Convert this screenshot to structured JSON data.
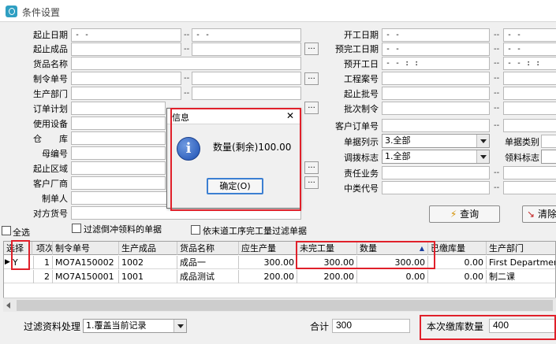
{
  "window": {
    "title": "条件设置"
  },
  "filters_left": [
    {
      "label": "起止日期",
      "from": "- -",
      "to": "- -"
    },
    {
      "label": "起止成品",
      "from": "",
      "to": ""
    },
    {
      "label": "货品名称",
      "value": ""
    },
    {
      "label": "制令单号",
      "from": "",
      "to": ""
    },
    {
      "label": "生产部门",
      "from": "",
      "to": ""
    },
    {
      "label": "订单计划",
      "from": "",
      "to": ""
    },
    {
      "label": "使用设备",
      "from": "",
      "to": ""
    },
    {
      "label": "仓　　库",
      "from": "",
      "to": ""
    },
    {
      "label": "母编号",
      "from": "",
      "to": ""
    },
    {
      "label": "起止区域",
      "from": "",
      "to": ""
    },
    {
      "label": "客户厂商",
      "from": "",
      "to": ""
    },
    {
      "label": "制单人",
      "value": ""
    },
    {
      "label": "对方货号",
      "value": ""
    }
  ],
  "filters_right": [
    {
      "label": "开工日期",
      "from": "- -",
      "to": "- -"
    },
    {
      "label": "预完工日期",
      "from": "- -",
      "to": "- -"
    },
    {
      "label": "预开工日",
      "from": "- -   : :",
      "to": "- -   : :"
    },
    {
      "label": "工程案号",
      "from": "",
      "to": ""
    },
    {
      "label": "起止批号",
      "from": "",
      "to": ""
    },
    {
      "label": "批次制令",
      "from": "",
      "to": ""
    },
    {
      "label": "客户订单号",
      "from": "",
      "to": ""
    }
  ],
  "doc_list_label": "单据列示",
  "doc_list_value": "3.全部",
  "doc_type_label": "单据类别",
  "transfer_flag_label": "调拨标志",
  "transfer_flag_value": "1.全部",
  "issue_flag_label": "领料标志",
  "responsible_label": "责任业务",
  "middle_code_label": "中类代号",
  "dots": "...",
  "query_button": "查询",
  "clear_button": "清除",
  "select_all_label": "全选",
  "filter_reverse_label": "过滤倒冲领料的单据",
  "filter_incomplete_label": "依末道工序完工量过滤单据",
  "table": {
    "headers": [
      "选择",
      "项次",
      "制令单号",
      "生产成品",
      "货品名称",
      "应生产量",
      "未完工量",
      "数量",
      "已缴库量",
      "生产部门"
    ],
    "rows": [
      [
        "Y",
        "1",
        "MO7A150002",
        "1002",
        "成品一",
        "300.00",
        "300.00",
        "300.00",
        "0.00",
        "First Department"
      ],
      [
        "",
        "2",
        "MO7A150001",
        "1001",
        "成品测试",
        "200.00",
        "200.00",
        "0.00",
        "0.00",
        "制二课"
      ]
    ]
  },
  "footer": {
    "filter_label": "过滤资料处理",
    "filter_value": "1.覆盖当前记录",
    "total_label": "合计",
    "total_value": "300",
    "receipt_label": "本次缴库数量",
    "receipt_value": "400"
  },
  "dialog": {
    "title": "信息",
    "message": "数量(剩余)100.00",
    "ok_button": "确定(O)",
    "close_symbol": "✕"
  },
  "colors": {
    "highlight": "#e0202a",
    "selected_row": "#ffffff"
  }
}
